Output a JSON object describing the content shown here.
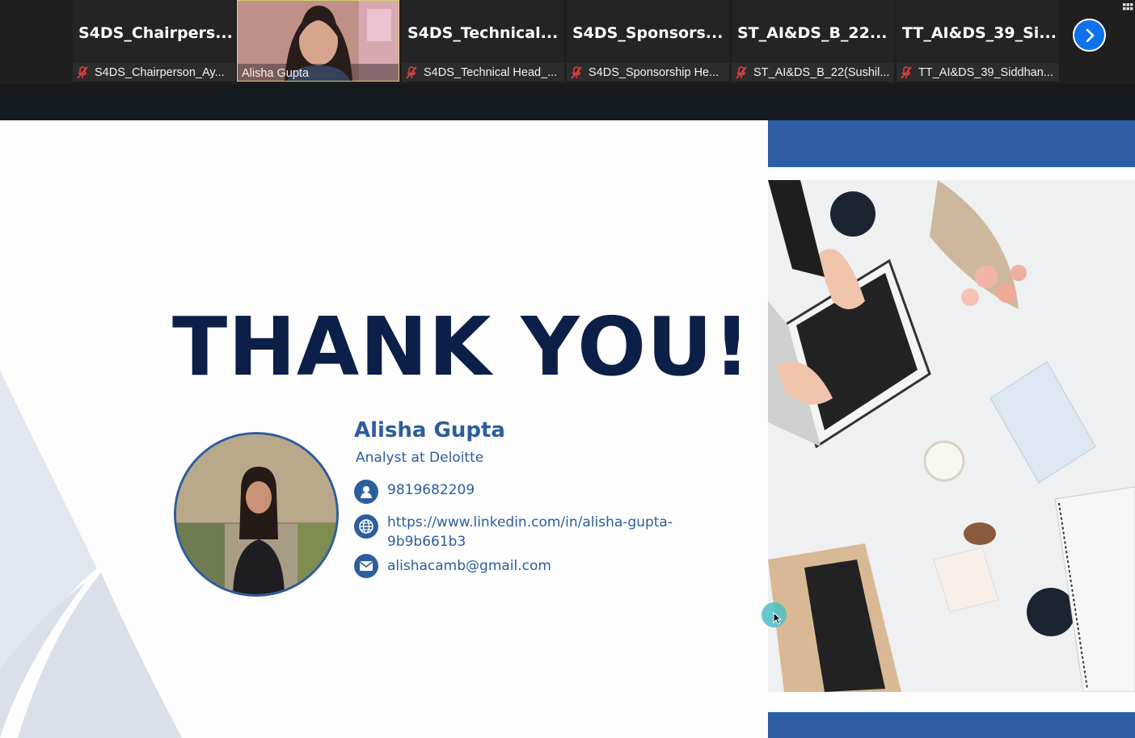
{
  "meeting": {
    "participants": [
      {
        "display_name": "S4DS_Chairpers...",
        "label": "S4DS_Chairperson_Ay...",
        "muted": true
      },
      {
        "display_name": "",
        "label": "Alisha Gupta",
        "muted": false,
        "video": true
      },
      {
        "display_name": "S4DS_Technical...",
        "label": "S4DS_Technical Head_...",
        "muted": true
      },
      {
        "display_name": "S4DS_Sponsors...",
        "label": "S4DS_Sponsorship He...",
        "muted": true
      },
      {
        "display_name": "ST_AI&DS_B_22...",
        "label": "ST_AI&DS_B_22(Sushil...",
        "muted": true
      },
      {
        "display_name": "TT_AI&DS_39_Si...",
        "label": "TT_AI&DS_39_Siddhan...",
        "muted": true
      }
    ],
    "next_icon": "chevron-right-icon",
    "view_icon": "grid-view-icon",
    "mic_icon": "mic-muted-icon",
    "colors": {
      "accent": "#0e72ed",
      "muted": "#e03d3d",
      "speaker_border": "#cfd36e"
    }
  },
  "slide": {
    "heading": "THANK YOU!",
    "presenter": {
      "name": "Alisha Gupta",
      "role": "Analyst at Deloitte",
      "phone": "9819682209",
      "linkedin_line1": "https://www.linkedin.com/in/alisha-gupta-",
      "linkedin_line2": "9b9b661b3",
      "email": "alishacamb@gmail.com"
    },
    "icons": {
      "phone": "user-icon",
      "web": "globe-icon",
      "email": "mail-icon"
    },
    "colors": {
      "heading": "#0c1f48",
      "accent": "#2c5d9d",
      "bar": "#2e5da6"
    }
  }
}
